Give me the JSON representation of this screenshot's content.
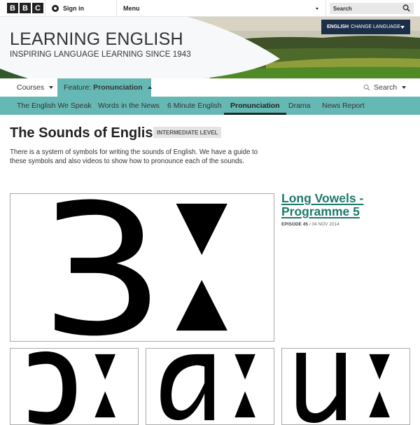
{
  "bbc_bar": {
    "logo_letters": [
      "B",
      "B",
      "C"
    ],
    "signin_label": "Sign in",
    "menu_label": "Menu",
    "search_placeholder": "Search"
  },
  "banner": {
    "title": "LEARNING ENGLISH",
    "subtitle": "INSPIRING LANGUAGE LEARNING SINCE 1943",
    "language_current": "ENGLISH",
    "language_action": "CHANGE LANGUAGE"
  },
  "primary_nav": {
    "courses_label": "Courses",
    "feature_prefix": "Feature:",
    "feature_name": "Pronunciation",
    "search_label": "Search"
  },
  "secondary_nav": {
    "items": [
      {
        "label": "The English We Speak",
        "active": false
      },
      {
        "label": "Words in the News",
        "active": false
      },
      {
        "label": "6 Minute English",
        "active": false
      },
      {
        "label": "Pronunciation",
        "active": true
      },
      {
        "label": "Drama",
        "active": false
      },
      {
        "label": "News Report",
        "active": false
      }
    ]
  },
  "content": {
    "title": "The Sounds of English",
    "level": "INTERMEDIATE LEVEL",
    "intro": "There is a system of symbols for writing the sounds of English. We have a guide to these symbols and also videos to show how to pronounce each of the sounds."
  },
  "featured": {
    "title": "Long Vowels - Programme 5",
    "episode_label": "EPISODE 45",
    "date": "04 NOV 2014",
    "symbol": "ɜː"
  },
  "thumbnails": [
    {
      "symbol": "ɔː"
    },
    {
      "symbol": "ɑː"
    },
    {
      "symbol": "uː"
    }
  ],
  "colors": {
    "teal_nav": "#66b8b4",
    "link_green": "#1d7a6a",
    "language_button": "#1c2f4a"
  }
}
